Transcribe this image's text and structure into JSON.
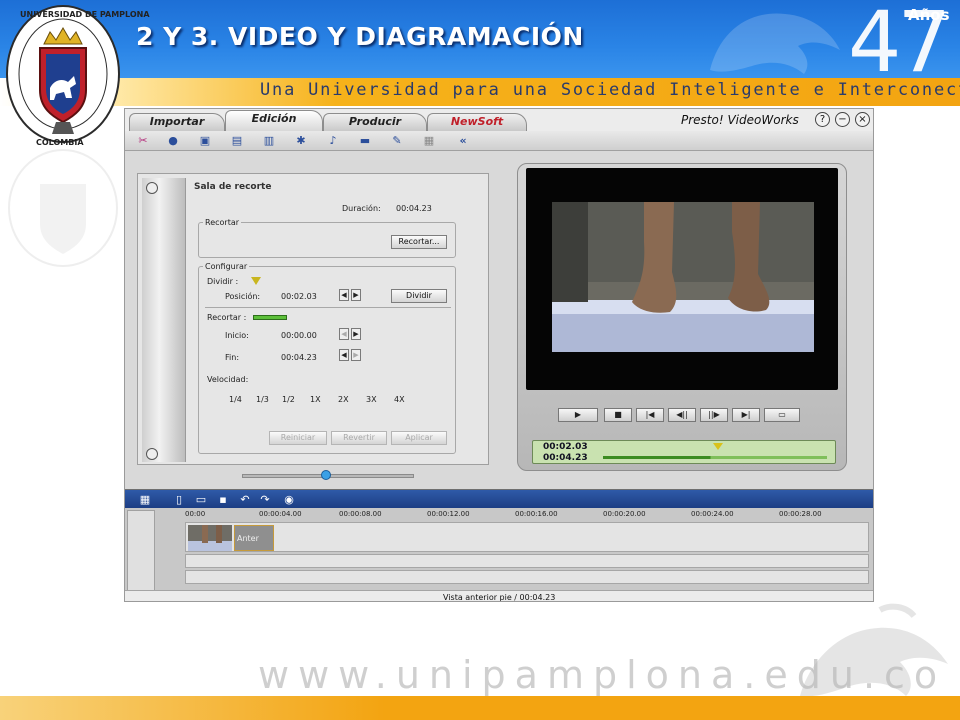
{
  "slide": {
    "title": "2 Y 3. VIDEO Y DIAGRAMACIÓN",
    "slogan": "Una Universidad para una Sociedad Inteligente e Interconectada",
    "anniversary_label": "Años",
    "anniversary_number": "47",
    "footer_url": "www.unipamplona.edu.co",
    "crest_text_top": "UNIVERSIDAD DE PAMPLONA",
    "crest_text_bottom": "COLOMBIA",
    "colors": {
      "header_blue": "#1d6fd6",
      "header_orange": "#f3a411",
      "title_shadow": "#0a2d6b"
    }
  },
  "app": {
    "name": "Presto! VideoWorks",
    "tabs": [
      {
        "label": "Importar",
        "active": false
      },
      {
        "label": "Edición",
        "active": true
      },
      {
        "label": "Producir",
        "active": false
      },
      {
        "label": "NewSoft",
        "active": false
      }
    ],
    "window_buttons": [
      "?",
      "−",
      "×"
    ],
    "toolbar_icons": [
      "scissors-icon",
      "effects-icon",
      "photo-icon",
      "transition-icon",
      "overlay-icon",
      "text-icon",
      "audio-icon",
      "narration-icon",
      "tools-icon",
      "settings-icon",
      "collapse-icon"
    ],
    "toolbar_collapse_glyph": "«"
  },
  "trim_panel": {
    "title": "Sala de recorte",
    "duration_label": "Duración:",
    "duration_value": "00:04.23",
    "group_trim": {
      "label": "Recortar",
      "button": "Recortar..."
    },
    "group_config": {
      "label": "Configurar",
      "split_label": "Dividir :",
      "position_label": "Posición:",
      "position_value": "00:02.03",
      "split_button": "Dividir",
      "trim_label": "Recortar :",
      "start_label": "Inicio:",
      "start_value": "00:00.00",
      "end_label": "Fin:",
      "end_value": "00:04.23",
      "speed_label": "Velocidad:",
      "speed_options": [
        "1/4",
        "1/3",
        "1/2",
        "1X",
        "2X",
        "3X",
        "4X"
      ],
      "speed_selected": "1X",
      "reset_button": "Reiniciar",
      "undo_button": "Revertir",
      "apply_button": "Aplicar"
    }
  },
  "preview": {
    "current_time": "00:02.03",
    "total_time": "00:04.23",
    "controls": [
      "play-icon",
      "stop-icon",
      "previous-icon",
      "step-back-icon",
      "step-forward-icon",
      "next-icon",
      "snapshot-icon"
    ],
    "progress": 0.48
  },
  "timeline": {
    "ruler": [
      "00:00",
      "00:00:04.00",
      "00:00:08.00",
      "00:00:12.00",
      "00:00:16.00",
      "00:00:20.00",
      "00:00:24.00",
      "00:00:28.00"
    ],
    "clip_label": "Anter",
    "status": "Vista anterior pie / 00:04.23"
  }
}
